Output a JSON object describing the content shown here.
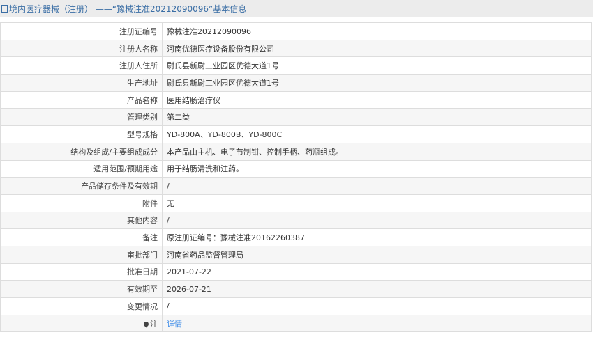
{
  "header": {
    "title": "境内医疗器械（注册） ——“豫械注准20212090096”基本信息"
  },
  "rows": [
    {
      "label": "注册证编号",
      "value": "豫械注准20212090096"
    },
    {
      "label": "注册人名称",
      "value": "河南优德医疗设备股份有限公司"
    },
    {
      "label": "注册人住所",
      "value": "尉氏县新尉工业园区优德大道1号"
    },
    {
      "label": "生产地址",
      "value": "尉氏县新尉工业园区优德大道1号"
    },
    {
      "label": "产品名称",
      "value": "医用结肠治疗仪"
    },
    {
      "label": "管理类别",
      "value": "第二类"
    },
    {
      "label": "型号规格",
      "value": "YD-800A、YD-800B、YD-800C"
    },
    {
      "label": "结构及组成/主要组成成分",
      "value": "本产品由主机、电子节制钳、控制手柄、药瓶组成。"
    },
    {
      "label": "适用范围/预期用途",
      "value": "用于结肠清洗和注药。"
    },
    {
      "label": "产品储存条件及有效期",
      "value": "/"
    },
    {
      "label": "附件",
      "value": "无"
    },
    {
      "label": "其他内容",
      "value": "/"
    },
    {
      "label": "备注",
      "value": "原注册证编号：豫械注准20162260387"
    },
    {
      "label": "审批部门",
      "value": "河南省药品监督管理局"
    },
    {
      "label": "批准日期",
      "value": "2021-07-22"
    },
    {
      "label": "有效期至",
      "value": "2026-07-21"
    },
    {
      "label": "变更情况",
      "value": "/"
    }
  ],
  "note": {
    "label": "注",
    "link": "详情"
  }
}
